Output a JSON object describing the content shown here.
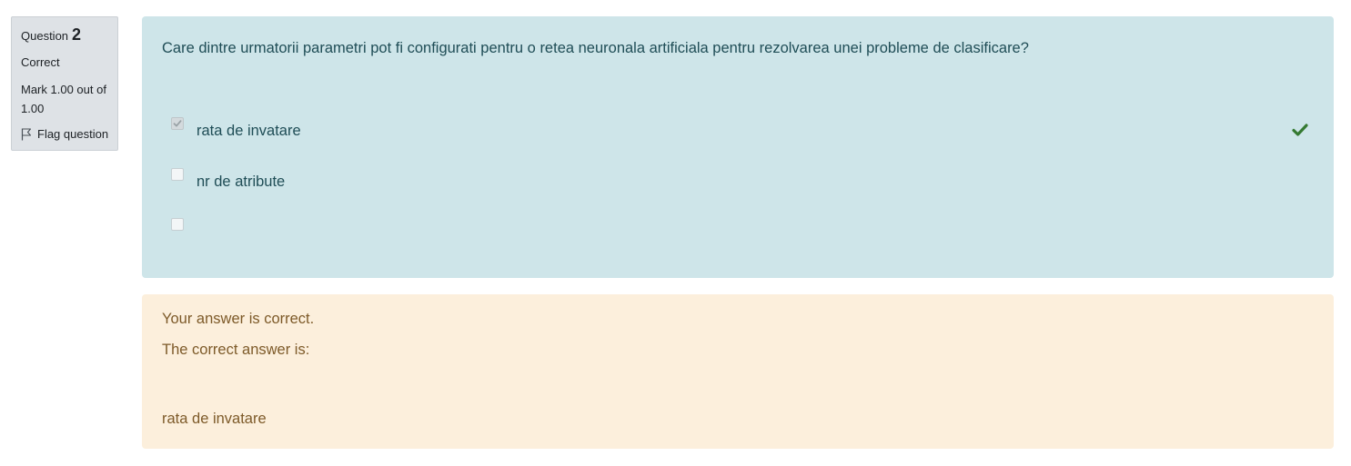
{
  "info": {
    "question_word": "Question",
    "question_number": "2",
    "state": "Correct",
    "grade": "Mark 1.00 out of 1.00",
    "flag_label": "Flag question",
    "flag_icon": "flag-outline-icon"
  },
  "question": {
    "text": "Care dintre urmatorii parametri pot fi configurati pentru o retea neuronala artificiala pentru rezolvarea unei probleme de clasificare?",
    "options": [
      {
        "label": "rata de invatare",
        "checked": true,
        "correct_mark": true
      },
      {
        "label": "nr de atribute",
        "checked": false,
        "correct_mark": false
      },
      {
        "label": "",
        "checked": false,
        "correct_mark": false
      }
    ],
    "correct_icon": "check-icon",
    "correct_icon_color": "#357a32"
  },
  "feedback": {
    "message": "Your answer is correct.",
    "right_answer_intro": "The correct answer is:",
    "right_answer": "rata de invatare"
  },
  "colors": {
    "formulation_bg": "#cee5e9",
    "formulation_text": "#1f4d56",
    "outcome_bg": "#fcefdc",
    "outcome_text": "#7d5a29",
    "info_bg": "#dee2e6"
  }
}
